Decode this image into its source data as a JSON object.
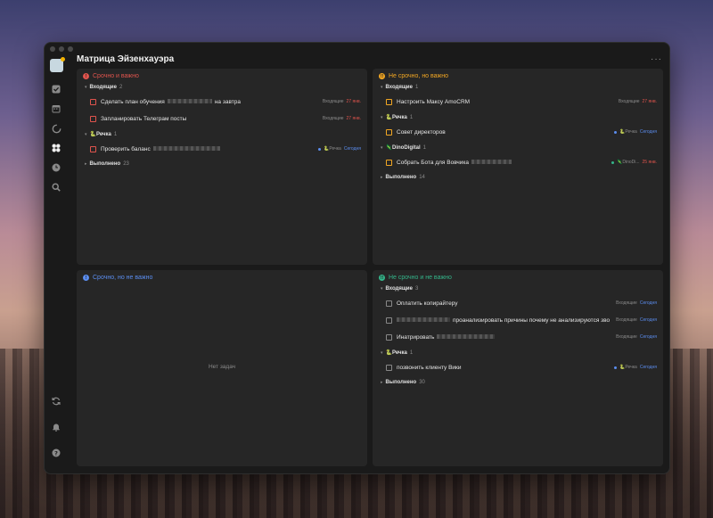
{
  "window": {
    "title": "Матрица Эйзенхауэра",
    "more": "···"
  },
  "colors": {
    "q1": "#e0544d",
    "q2": "#f2a723",
    "q3": "#5b8def",
    "q4": "#34b58a"
  },
  "sidebar_icons": [
    "avatar",
    "check-icon",
    "calendar-icon",
    "timer-icon",
    "matrix-icon",
    "clock-icon",
    "search-icon"
  ],
  "sidebar_bottom_icons": [
    "sync-icon",
    "bell-icon",
    "help-icon"
  ],
  "quadrants": [
    {
      "title": "Срочно и важно",
      "groups": [
        {
          "name": "Входящие",
          "count": "2",
          "tasks": [
            {
              "pre": "Сделать план обучения",
              "post": "на завтра",
              "list": "Входящие",
              "date": "27 янв."
            },
            {
              "pre": "Запланировать Телеграм посты",
              "post": "",
              "list": "Входящие",
              "date": "27 янв."
            }
          ]
        },
        {
          "name": "🐍Речка",
          "count": "1",
          "tasks": [
            {
              "pre": "Проверить баланс",
              "post": "",
              "list": "🐍Речка",
              "date": "Сегодня"
            }
          ]
        }
      ],
      "done": {
        "label": "Выполнено",
        "count": "23"
      }
    },
    {
      "title": "Не срочно, но важно",
      "groups": [
        {
          "name": "Входящие",
          "count": "1",
          "tasks": [
            {
              "pre": "Настроить Максу AmoCRM",
              "post": "",
              "list": "Входящие",
              "date": "27 янв."
            }
          ]
        },
        {
          "name": "🐍Речка",
          "count": "1",
          "tasks": [
            {
              "pre": "Совет директоров",
              "post": "",
              "list": "🐍Речка",
              "date": "Сегодня"
            }
          ]
        },
        {
          "name": "🦎DinoDigital",
          "count": "1",
          "tasks": [
            {
              "pre": "Собрать Бота для Вовчика",
              "post": "",
              "list": "🦎DinoDi...",
              "date": "25 янв."
            }
          ]
        }
      ],
      "done": {
        "label": "Выполнено",
        "count": "14"
      }
    },
    {
      "title": "Срочно, но не важно",
      "empty": "Нет задач"
    },
    {
      "title": "Не срочно и не важно",
      "groups": [
        {
          "name": "Входящие",
          "count": "3",
          "tasks": [
            {
              "pre": "Оплатить копирайтеру",
              "post": "",
              "list": "Входящие",
              "date": "Сегодня"
            },
            {
              "pre": "",
              "post": "проанализировать причины почему не анализируются зво",
              "list": "Входящие",
              "date": "Сегодня"
            },
            {
              "pre": "Инатрировать",
              "post": "",
              "list": "Входящие",
              "date": "Сегодня"
            }
          ]
        },
        {
          "name": "🐍Речка",
          "count": "1",
          "tasks": [
            {
              "pre": "позвонить клиенту Вики",
              "post": "",
              "list": "🐍Речка",
              "date": "Сегодня"
            }
          ]
        }
      ],
      "done": {
        "label": "Выполнено",
        "count": "30"
      }
    }
  ]
}
